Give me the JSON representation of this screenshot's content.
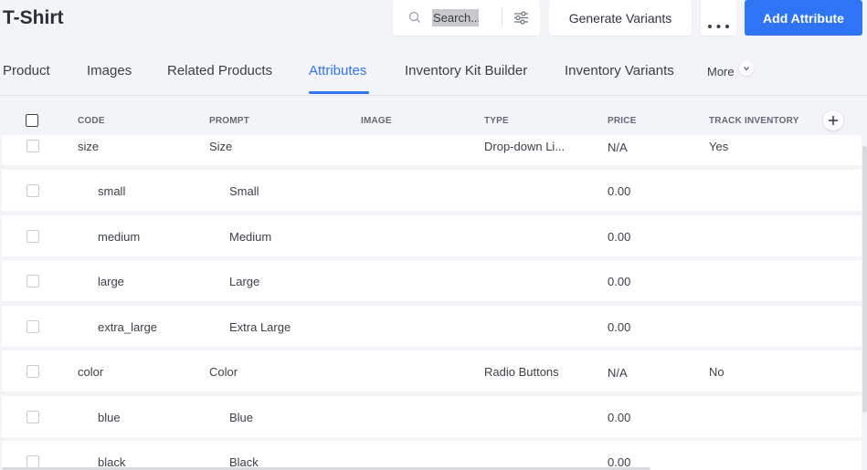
{
  "page": {
    "title": "T-Shirt"
  },
  "toolbar": {
    "search_placeholder": "Search...",
    "generate_label": "Generate Variants",
    "more_label": "•••",
    "add_label": "Add Attribute",
    "accent": "#2e74f5"
  },
  "tabs": [
    {
      "label": "Product"
    },
    {
      "label": "Images"
    },
    {
      "label": "Related Products"
    },
    {
      "label": "Attributes",
      "active": true
    },
    {
      "label": "Inventory Kit Builder"
    },
    {
      "label": "Inventory Variants"
    }
  ],
  "tab_more": {
    "label": "More"
  },
  "table": {
    "headers": [
      "CODE",
      "PROMPT",
      "IMAGE",
      "TYPE",
      "PRICE",
      "TRACK INVENTORY"
    ],
    "rows": [
      {
        "code": "size",
        "prompt": "Size",
        "image": "",
        "type": "Drop-down Li...",
        "price": "N/A",
        "track": "Yes",
        "child": false
      },
      {
        "code": "small",
        "prompt": "Small",
        "image": "",
        "type": "",
        "price": "0.00",
        "track": "",
        "child": true
      },
      {
        "code": "medium",
        "prompt": "Medium",
        "image": "",
        "type": "",
        "price": "0.00",
        "track": "",
        "child": true
      },
      {
        "code": "large",
        "prompt": "Large",
        "image": "",
        "type": "",
        "price": "0.00",
        "track": "",
        "child": true
      },
      {
        "code": "extra_large",
        "prompt": "Extra Large",
        "image": "",
        "type": "",
        "price": "0.00",
        "track": "",
        "child": true
      },
      {
        "code": "color",
        "prompt": "Color",
        "image": "",
        "type": "Radio Buttons",
        "price": "N/A",
        "track": "No",
        "child": false
      },
      {
        "code": "blue",
        "prompt": "Blue",
        "image": "",
        "type": "",
        "price": "0.00",
        "track": "",
        "child": true
      },
      {
        "code": "black",
        "prompt": "Black",
        "image": "",
        "type": "",
        "price": "0.00",
        "track": "",
        "child": true
      }
    ]
  },
  "icons": {
    "search": "search-icon",
    "filter": "filter-sliders-icon",
    "more": "more-dots-icon",
    "chevron": "chevron-down-icon",
    "add_column": "plus-icon"
  }
}
